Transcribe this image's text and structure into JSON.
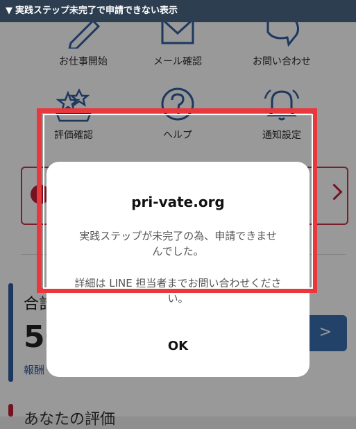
{
  "header": {
    "arrow": "▼",
    "title": "実践ステップ未完了で申請できない表示"
  },
  "menu": [
    {
      "label": "お仕事開始",
      "icon": "pencil-icon"
    },
    {
      "label": "メール確認",
      "icon": "envelope-icon"
    },
    {
      "label": "お問い合わせ",
      "icon": "chat-bubble-icon"
    },
    {
      "label": "評価確認",
      "icon": "stars-hand-icon"
    },
    {
      "label": "ヘルプ",
      "icon": "question-circle-icon"
    },
    {
      "label": "通知設定",
      "icon": "bell-icon"
    }
  ],
  "summary": {
    "label": "合計",
    "value": "50",
    "link": "報酬"
  },
  "next_section": {
    "label": "あなたの評価"
  },
  "go_button": {
    "label": ">"
  },
  "dialog": {
    "title": "pri-vate.org",
    "message": "実践ステップが未完了の為、申請できませんでした。",
    "detail": "詳細は LINE 担当者までお問い合わせください。",
    "ok_label": "OK"
  },
  "colors": {
    "header_bg": "#2c3e50",
    "highlight": "#e8383d",
    "accent_blue": "#2f5e9e",
    "accent_red": "#c0203a"
  }
}
